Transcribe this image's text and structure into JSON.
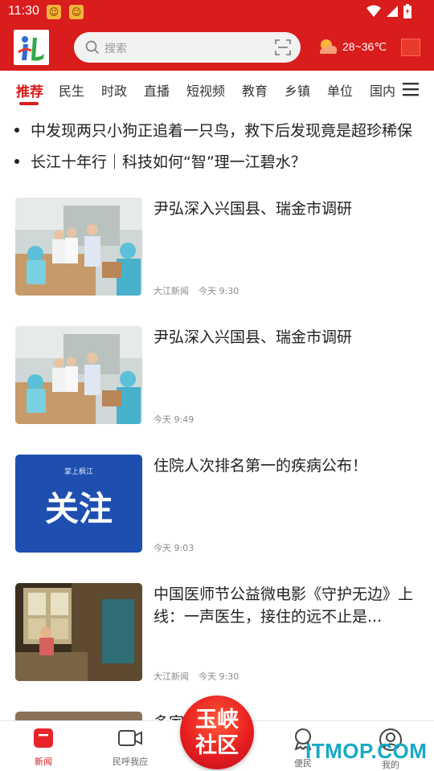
{
  "status_bar": {
    "time": "11:30",
    "app_icons": [
      "notification-app-icon",
      "notification-app-icon"
    ],
    "icons": [
      "wifi-icon",
      "signal-icon",
      "battery-icon"
    ]
  },
  "header": {
    "logo": "app-logo",
    "search": {
      "placeholder": "搜索"
    },
    "weather": {
      "text": "28~36℃"
    }
  },
  "tabs": [
    {
      "label": "推荐",
      "active": true
    },
    {
      "label": "民生"
    },
    {
      "label": "时政"
    },
    {
      "label": "直播"
    },
    {
      "label": "短视频"
    },
    {
      "label": "教育"
    },
    {
      "label": "乡镇"
    },
    {
      "label": "单位"
    },
    {
      "label": "国内"
    }
  ],
  "headlines": [
    "中发现两只小狗正追着一只鸟，救下后发现竟是超珍稀保",
    "长江十年行｜科技如何“智”理一江碧水？"
  ],
  "news": [
    {
      "title": "尹弘深入兴国县、瑞金市调研",
      "source": "大江新闻",
      "time": "今天 9:30",
      "thumb": "photo-factory"
    },
    {
      "title": "尹弘深入兴国县、瑞金市调研",
      "source": "",
      "time": "今天 9:49",
      "thumb": "photo-factory"
    },
    {
      "title": "住院人次排名第一的疾病公布！",
      "source": "",
      "time": "今天 9:03",
      "thumb": "blue-card",
      "thumb_caption": "关注",
      "thumb_brand": "掌上枫江"
    },
    {
      "title": "中国医师节公益微电影《守护无边》上线：一声医生，接住的远不止是...",
      "source": "大江新闻",
      "time": "今天 9:30",
      "thumb": "photo-room"
    },
    {
      "title": "多家…被罚！",
      "source": "",
      "time": "",
      "thumb": "photo-partial"
    }
  ],
  "bottom_nav": {
    "items": [
      {
        "label": "新闻",
        "icon": "news-icon",
        "active": true
      },
      {
        "label": "民呼我应",
        "icon": "video-camera-icon"
      },
      {
        "label": "便民",
        "icon": "badge-icon"
      },
      {
        "label": "我的",
        "icon": "user-icon"
      }
    ],
    "center": {
      "line1": "玉峡",
      "line2": "社区"
    }
  },
  "watermark": "ITMOP.COM",
  "colors": {
    "brand_red": "#d91c1c",
    "text": "#222222",
    "meta": "#8a8a8a"
  }
}
